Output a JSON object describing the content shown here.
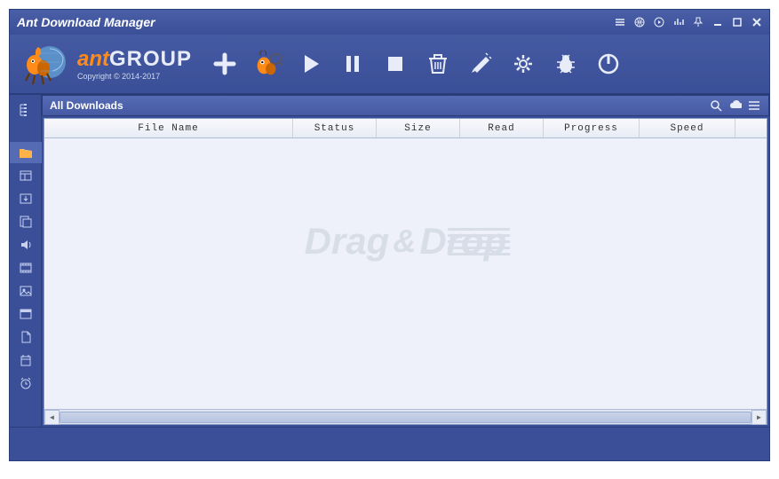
{
  "titlebar": {
    "title": "Ant Download Manager"
  },
  "brand": {
    "ant": "ant",
    "group": "GROUP",
    "copyright": "Copyright © 2014-2017"
  },
  "category": {
    "title": "All Downloads"
  },
  "columns": {
    "filename": "File Name",
    "status": "Status",
    "size": "Size",
    "read": "Read",
    "progress": "Progress",
    "speed": "Speed"
  },
  "watermark": {
    "drag": "Drag",
    "amp": "&",
    "drop": "Drop"
  }
}
